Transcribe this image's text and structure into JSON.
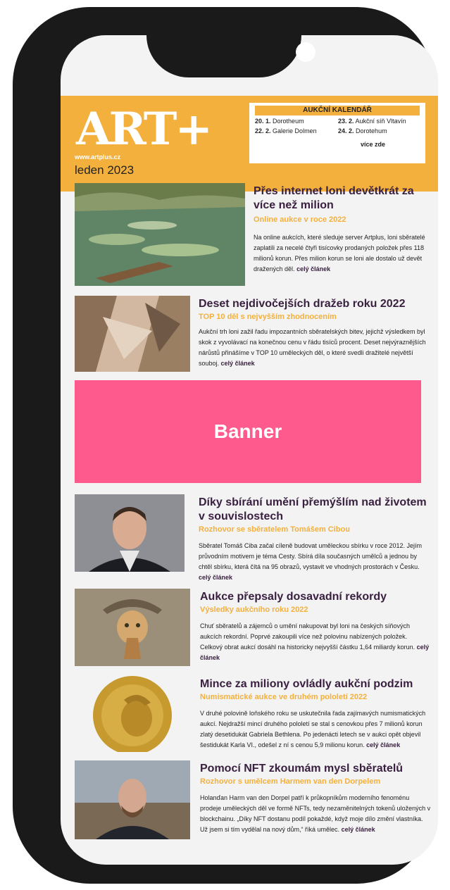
{
  "header": {
    "logo": "ART+",
    "url": "www.artplus.cz",
    "date": "leden 2023"
  },
  "calendar": {
    "title": "AUKČNÍ KALENDÁŘ",
    "items": [
      {
        "day": "20. 1.",
        "name": "Dorotheum"
      },
      {
        "day": "23. 2.",
        "name": "Aukční síň Vltavín"
      },
      {
        "day": "22. 2.",
        "name": "Galerie Dolmen"
      },
      {
        "day": "24. 2.",
        "name": "Dorotehum"
      }
    ],
    "more": "více zde"
  },
  "banner": {
    "label": "Banner"
  },
  "articles": [
    {
      "title": "Přes internet loni devětkrát za více než milion",
      "subtitle": "Online aukce v roce 2022",
      "body": "Na online aukcích, které sleduje server Artplus, loni sběratelé zaplatili za necelé čtyři tisícovky prodaných položek přes 118 milionů korun. Přes milion korun se loni ale dostalo už devět dražených děl.",
      "more": "celý článek"
    },
    {
      "title": "Deset nejdivočejších dražeb roku 2022",
      "subtitle": "TOP 10 děl s nejvyšším zhodnocením",
      "body": "Aukční trh loni zažil řadu impozantních sběratelských bitev, jejichž výsledkem byl skok z vyvolávací na konečnou cenu v řádu tisíců procent. Deset nejvýraznějších nárůstů přinášíme v TOP 10 uměleckých děl, o které svedli dražitelé největší souboj.",
      "more": "celý článek"
    },
    {
      "title": "Díky sbírání umění přemýšlím nad životem v souvislostech",
      "subtitle": "Rozhovor se sběratelem Tomášem Cibou",
      "body": "Sběratel Tomáš Ciba začal cíleně budovat uměleckou sbírku v roce 2012. Jejím průvodním motivem je téma Cesty. Sbírá díla současných umělců a jednou by chtěl sbírku, která čítá na 95 obrazů, vystavit ve vhodných prostorách v Česku.",
      "more": "celý článek"
    },
    {
      "title": "Aukce přepsaly dosavadní rekordy",
      "subtitle": "Výsledky aukčního roku 2022",
      "body": "Chuť sběratelů a zájemců o umění nakupovat byl loni na českých síňových aukcích rekordní. Poprvé zakoupili více než polovinu nabízených položek. Celkový obrat aukcí dosáhl na historicky nejvyšší částku 1,64 miliardy korun.",
      "more": "celý článek"
    },
    {
      "title": "Mince za miliony ovládly aukční podzim",
      "subtitle": "Numismatické aukce ve druhém pololetí 2022",
      "body": "V druhé polovině loňského roku se uskutečnila řada zajímavých numismatických aukcí. Nejdražší mincí druhého pololetí se stal s cenovkou přes 7 milionů korun zlatý desetidukát Gabriela Bethlena. Po jedenácti letech se v aukci opět objevil šestidukát Karla VI., odešel z ní s cenou 5,9 milionu korun.",
      "more": "celý článek"
    },
    {
      "title": "Pomocí NFT zkoumám mysl sběratelů",
      "subtitle": "Rozhovor s umělcem Harmem van den Dorpelem",
      "body": "Holanďan Harm van den Dorpel patří k průkopníkům moderního fenoménu prodeje uměleckých děl ve formě NFTs, tedy nezaměnitelných tokenů uložených v blockchainu. „Díky NFT dostanu podíl pokaždé, když moje dílo změní vlastníka. Už jsem si tím vydělal na nový dům,“ říká umělec.",
      "more": "celý článek"
    }
  ],
  "colors": {
    "accent": "#f3b03c",
    "banner": "#ff5a8e",
    "title": "#3a2040"
  }
}
